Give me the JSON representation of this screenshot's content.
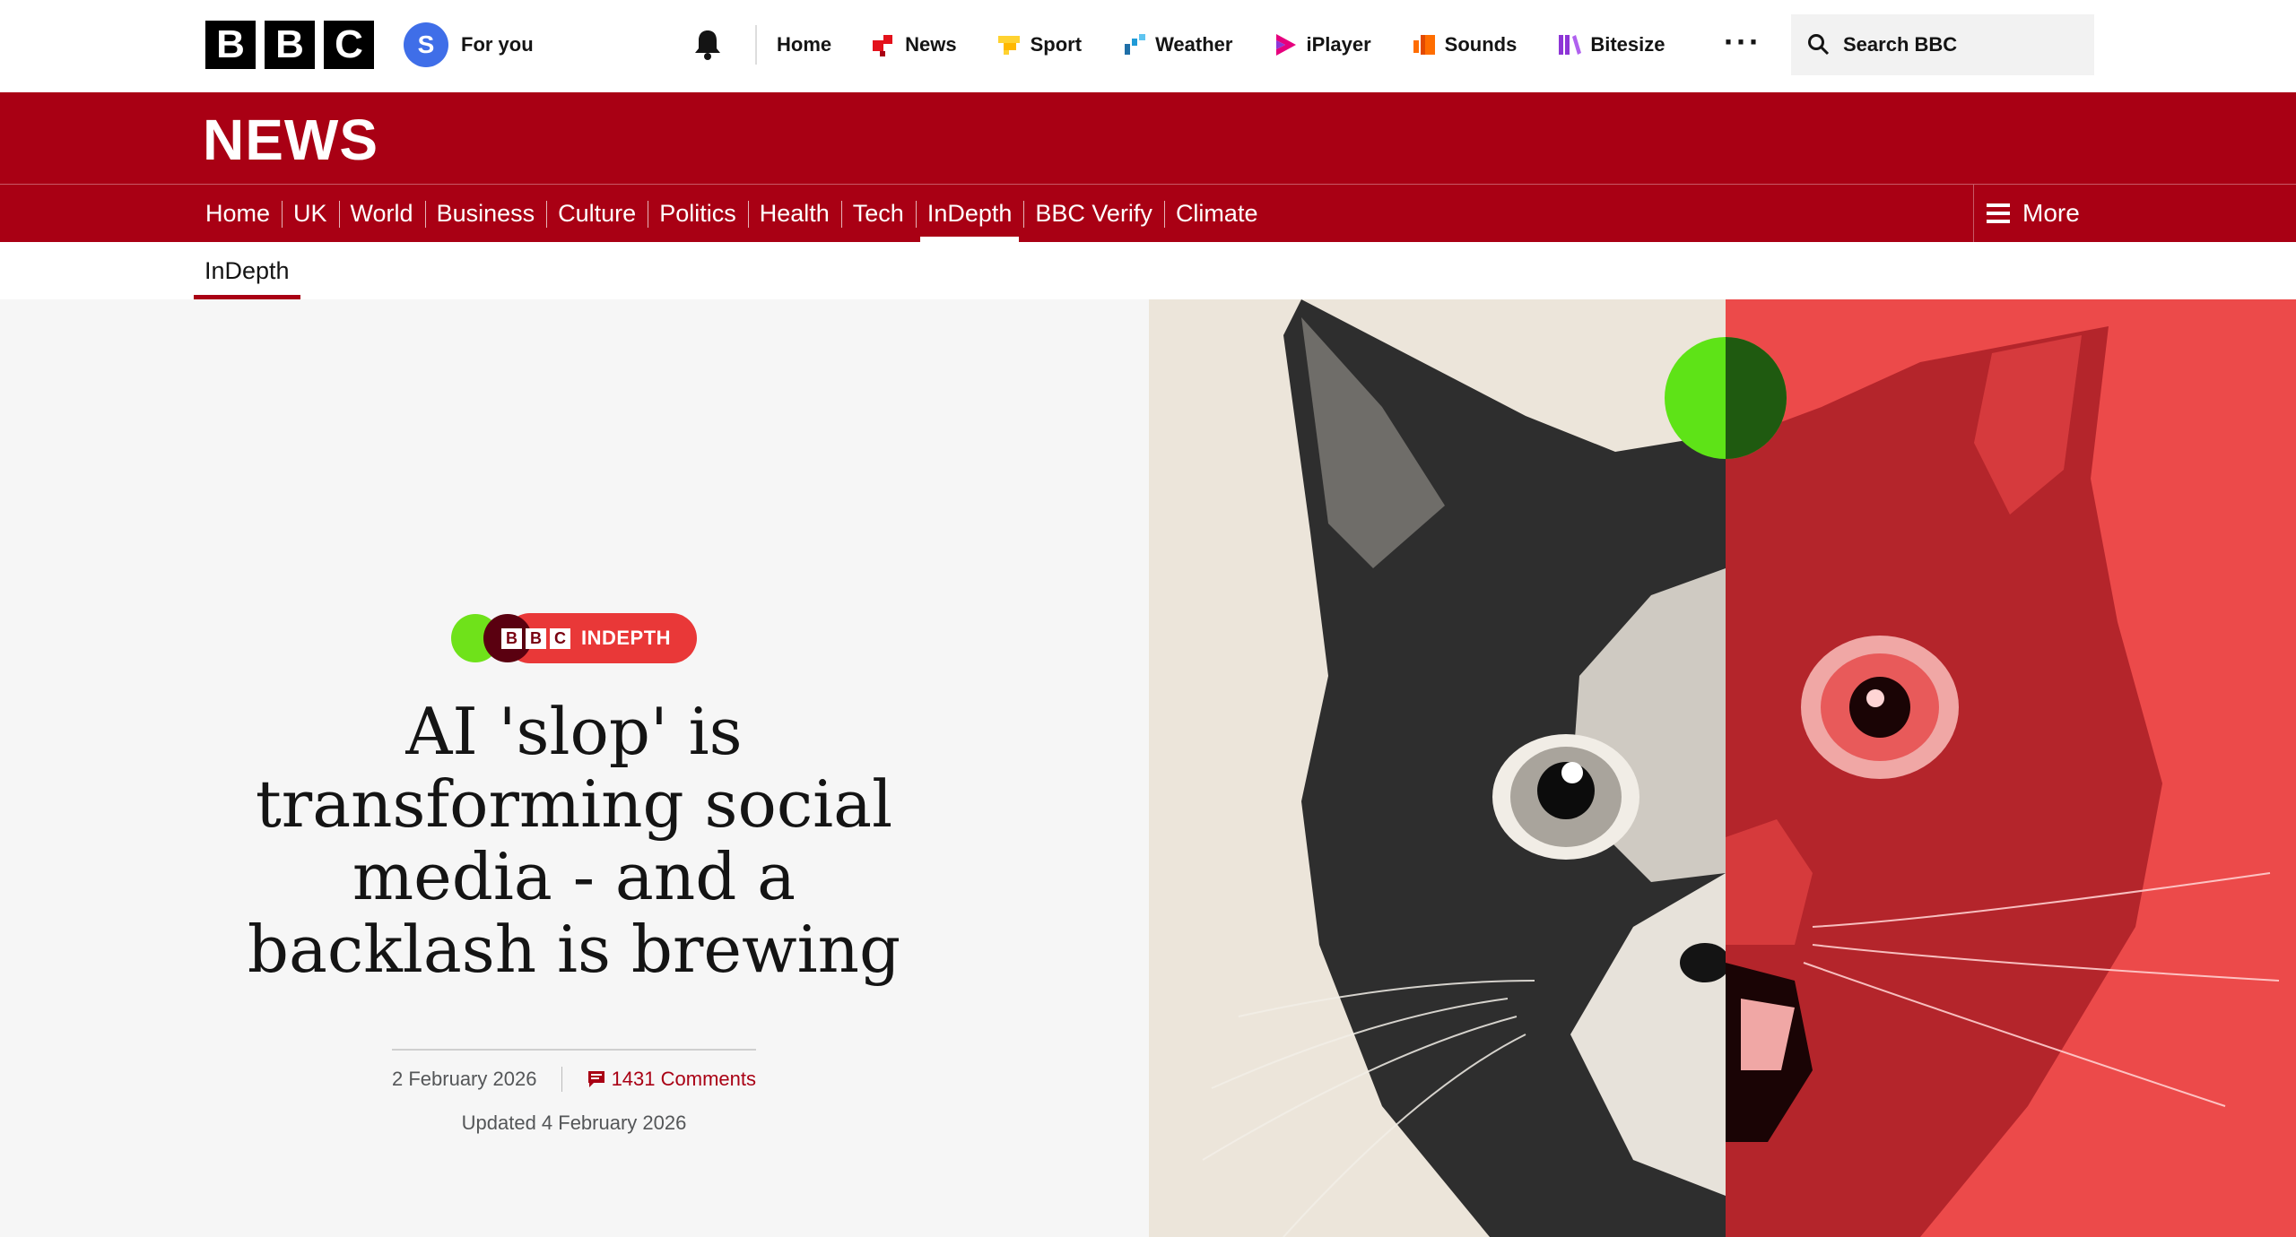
{
  "header": {
    "logo_letters": [
      "B",
      "B",
      "C"
    ],
    "avatar_initial": "S",
    "for_you_label": "For you",
    "nav": [
      {
        "label": "Home",
        "icon": "none"
      },
      {
        "label": "News",
        "icon": "news-icon",
        "color": "#e3111b"
      },
      {
        "label": "Sport",
        "icon": "sport-icon",
        "color": "#ffd230"
      },
      {
        "label": "Weather",
        "icon": "weather-icon",
        "color": "#1f9ad6"
      },
      {
        "label": "iPlayer",
        "icon": "iplayer-icon",
        "color": "#e6007e"
      },
      {
        "label": "Sounds",
        "icon": "sounds-icon",
        "color": "#ff6d00"
      },
      {
        "label": "Bitesize",
        "icon": "bitesize-icon",
        "color": "#8d35d6"
      }
    ],
    "more_label": "···",
    "search_label": "Search BBC"
  },
  "banner": {
    "title": "NEWS",
    "color": "#a90014"
  },
  "section_nav": {
    "items": [
      "Home",
      "UK",
      "World",
      "Business",
      "Culture",
      "Politics",
      "Health",
      "Tech",
      "InDepth",
      "BBC Verify",
      "Climate"
    ],
    "active": "InDepth",
    "more_label": "More"
  },
  "sub_nav": {
    "active_tab": "InDepth"
  },
  "article": {
    "badge_logo": [
      "B",
      "B",
      "C"
    ],
    "badge_label": "INDEPTH",
    "headline_lines": [
      "AI 'slop' is",
      "transforming social",
      "media - and a",
      "backlash is brewing"
    ],
    "date": "2 February 2026",
    "comments": "1431 Comments",
    "updated": "Updated 4 February 2026",
    "image_alt": "Two halves of a cat face, one calm in black and white, one hissing in red, with a green dot"
  }
}
